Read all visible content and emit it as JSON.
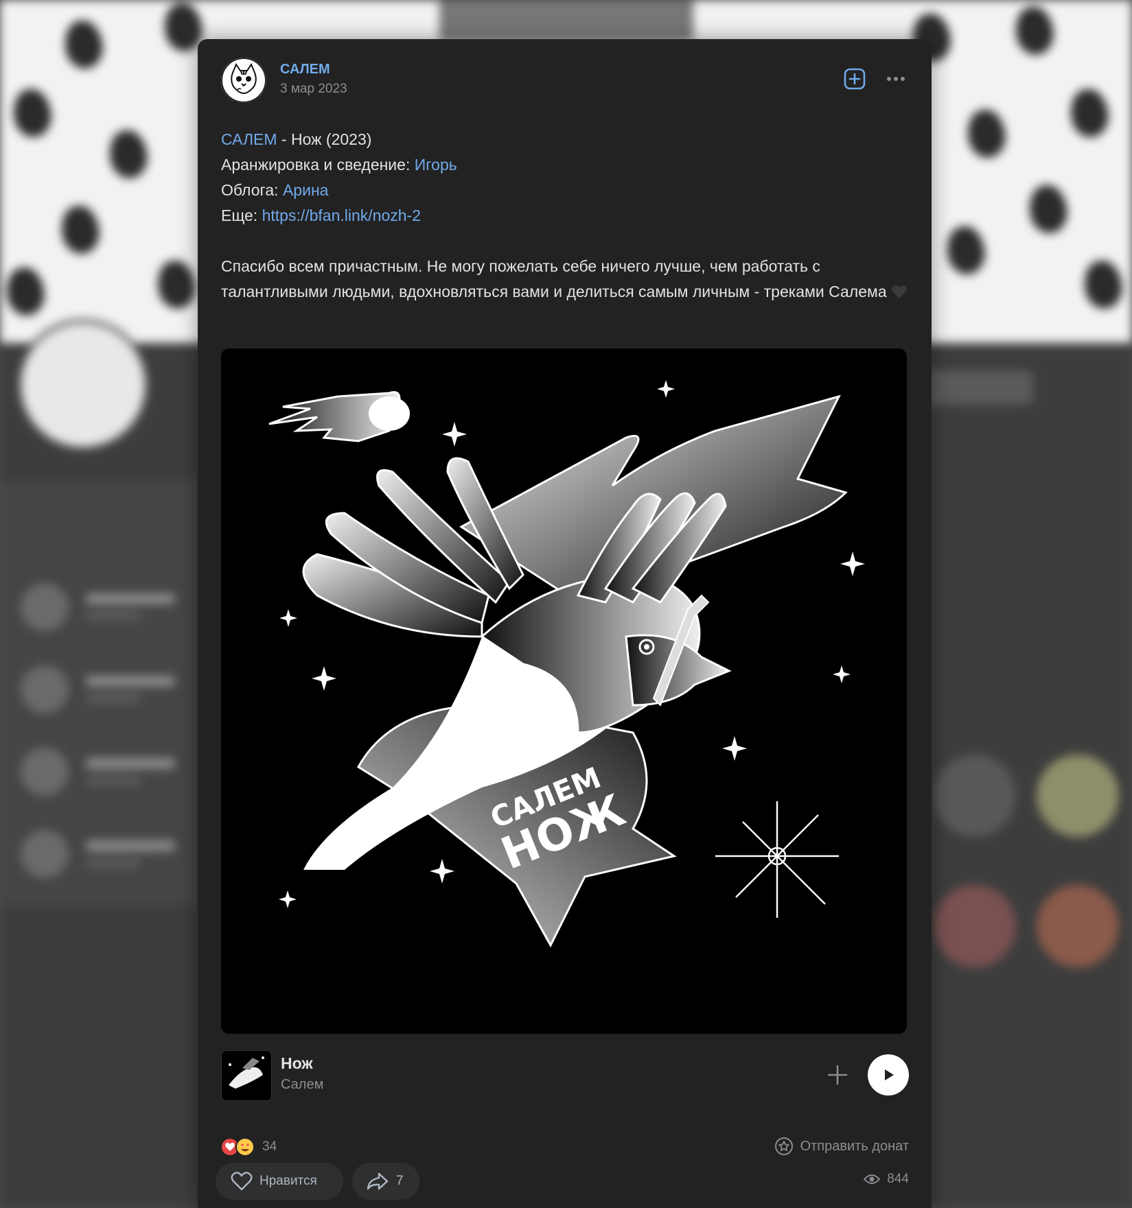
{
  "post": {
    "author": "САЛЕМ",
    "date": "3 мар 2023",
    "text": {
      "line1_link": "САЛЕМ",
      "line1_rest": " - Нож (2023)",
      "line2_label": "Аранжировка и сведение: ",
      "line2_link": "Игорь",
      "line3_label": "Облога: ",
      "line3_link": "Арина",
      "line4_label": "Еще: ",
      "line4_link": "https://bfan.link/nozh-2",
      "paragraph": "Спасибо всем причастным. Не могу пожелать себе ничего лучше, чем работать с талантливыми людьми, вдохновляться вами и делиться самым личным - треками Салема"
    },
    "cover_text": {
      "line1": "САЛЕМ",
      "line2": "НОЖ"
    }
  },
  "track": {
    "title": "Нож",
    "artist": "Салем"
  },
  "reactions": {
    "count": "34",
    "donate_label": "Отправить донат"
  },
  "actions": {
    "like_label": "Нравится",
    "share_count": "7",
    "views_count": "844"
  },
  "icons": {
    "subscribe": "add-square-icon",
    "more": "more-horizontal-icon",
    "add": "plus-icon",
    "play": "play-icon",
    "donate": "star-circle-icon",
    "like": "heart-outline-icon",
    "share": "share-arrow-icon",
    "views": "eye-icon"
  },
  "colors": {
    "card": "#222222",
    "link": "#71aaeb",
    "muted": "#8b8e92",
    "text": "#e1e3e6"
  }
}
